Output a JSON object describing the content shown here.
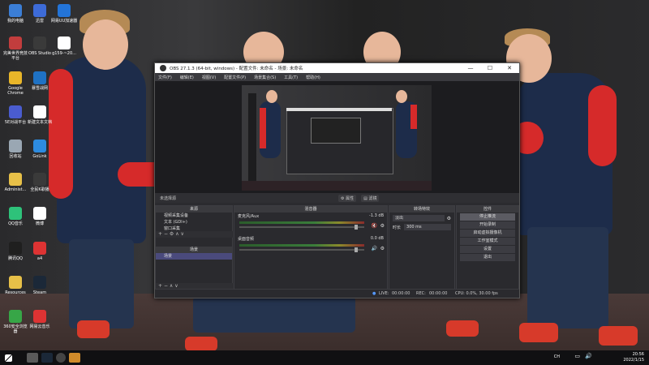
{
  "desktop": {
    "icons": [
      {
        "label": "我的电脑",
        "color": "#3b7ed6"
      },
      {
        "label": "迅雷",
        "color": "#3d6bd8"
      },
      {
        "label": "网易UU加速器",
        "color": "#2374d8"
      },
      {
        "label": "完美世界竞技平台",
        "color": "#c23d3d"
      },
      {
        "label": "OBS Studio",
        "color": "#3a3a3a"
      },
      {
        "label": "g159-~20...",
        "color": "#ffffff"
      },
      {
        "label": "Google Chrome",
        "color": "#e9b629"
      },
      {
        "label": "暴雪战网",
        "color": "#1f72c4"
      },
      {
        "label": "5E对战平台",
        "color": "#4a5ccf"
      },
      {
        "label": "新建文本文档",
        "color": "#ffffff"
      },
      {
        "label": "回收站",
        "color": "#9aa7b3"
      },
      {
        "label": "GoLink",
        "color": "#2d8be0"
      },
      {
        "label": "Administ...",
        "color": "#e7c048"
      },
      {
        "label": "全民K歌播",
        "color": "#3a3a3a"
      },
      {
        "label": "QQ音乐",
        "color": "#2ec27a"
      },
      {
        "label": "微博",
        "color": "#ffffff"
      },
      {
        "label": "腾讯QQ",
        "color": "#1f1f1f"
      },
      {
        "label": "a4",
        "color": "#d33"
      },
      {
        "label": "Resources",
        "color": "#e7c048"
      },
      {
        "label": "Steam",
        "color": "#1b2838"
      },
      {
        "label": "360安全浏览器",
        "color": "#37a647"
      },
      {
        "label": "网易云音乐",
        "color": "#d33"
      }
    ]
  },
  "obs": {
    "title": "OBS 27.1.3 (64-bit, windows) - 配置文件: 未命名 - 场景: 未命名",
    "menu": [
      "文件(F)",
      "编辑(E)",
      "视图(V)",
      "配置文件(P)",
      "场景集合(S)",
      "工具(T)",
      "帮助(H)"
    ],
    "no_source": "未选择源",
    "prop_btn": "属性",
    "filter_btn": "滤镜",
    "docks": {
      "sources": "来源",
      "mixer": "混音器",
      "transitions": "转场特效",
      "controls": "控件",
      "scenes": "场景"
    },
    "sources": [
      "视频采集设备",
      "文本 (GDI+)",
      "窗口采集"
    ],
    "scenes": [
      "场景"
    ],
    "mixer": {
      "ch1": "麦克风/Aux",
      "ch1_db": "-1.3 dB",
      "ch2": "桌面音频",
      "ch2_db": "0.0 dB"
    },
    "transition": {
      "type": "淡出",
      "duration_label": "时长",
      "duration": "300 ms"
    },
    "controls": [
      "停止推流",
      "开始录制",
      "启动虚拟摄像机",
      "工作室模式",
      "设置",
      "退出"
    ],
    "status": {
      "live": "LIVE:",
      "live_time": "00:00:00",
      "rec": "REC:",
      "rec_time": "00:00:00",
      "cpu": "CPU: 0.0%, 30.00 fps"
    }
  },
  "taskbar": {
    "time": "20:56",
    "date": "2022/1/15",
    "lang": "CH"
  }
}
